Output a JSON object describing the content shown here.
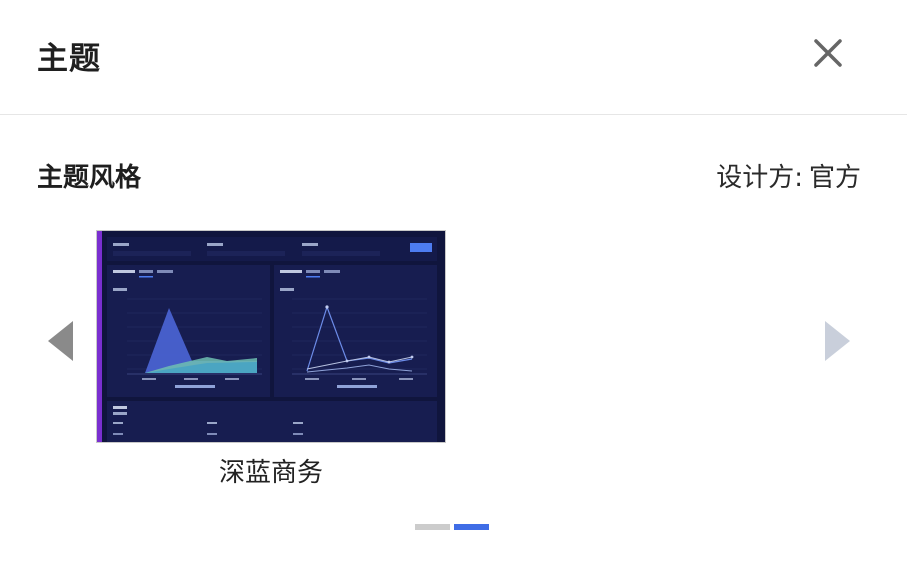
{
  "header": {
    "title": "主题",
    "close_icon": "close-icon"
  },
  "section": {
    "title": "主题风格",
    "designer_label": "设计方:",
    "designer_value": "官方"
  },
  "carousel": {
    "prev_icon": "triangle-left-icon",
    "next_icon": "triangle-right-icon",
    "items": [
      {
        "label": "深蓝商务",
        "accent": "#4d7cf0",
        "background": "#10153d"
      }
    ],
    "pages": 2,
    "active_page": 2,
    "dot_colors": {
      "inactive": "#cccccc",
      "active": "#3f6de6"
    }
  }
}
